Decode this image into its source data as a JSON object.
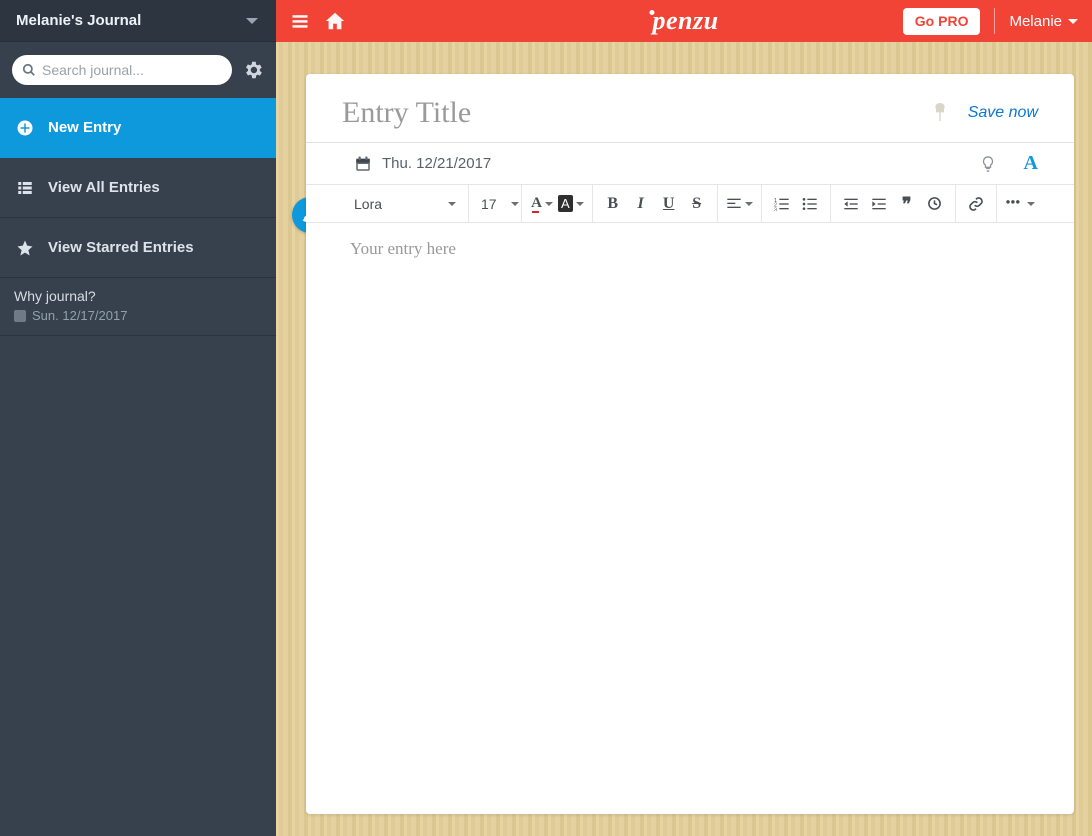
{
  "sidebar": {
    "title": "Melanie's Journal",
    "search_placeholder": "Search journal...",
    "new_entry_label": "New Entry",
    "view_all_label": "View All Entries",
    "view_starred_label": "View Starred Entries",
    "recent_entry": {
      "title": "Why journal?",
      "date": "Sun. 12/17/2017"
    }
  },
  "topbar": {
    "brand": "penzu",
    "go_pro_label": "Go PRO",
    "user_name": "Melanie"
  },
  "editor": {
    "title_placeholder": "Entry Title",
    "save_label": "Save now",
    "date": "Thu. 12/21/2017",
    "body_placeholder": "Your entry here",
    "font_family": "Lora",
    "font_size": "17"
  }
}
